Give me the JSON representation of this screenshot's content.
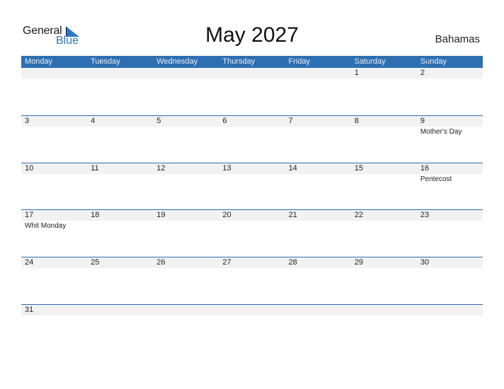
{
  "logo": {
    "text_general": "General",
    "text_blue": "Blue",
    "icon": "logo-triangle-icon"
  },
  "title": "May 2027",
  "country": "Bahamas",
  "colors": {
    "accent": "#2e6fb2",
    "logo_blue": "#2a76c6",
    "strip": "#f2f2f2"
  },
  "weekdays": [
    "Monday",
    "Tuesday",
    "Wednesday",
    "Thursday",
    "Friday",
    "Saturday",
    "Sunday"
  ],
  "weeks": [
    [
      "",
      "",
      "",
      "",
      "",
      "1",
      "2"
    ],
    [
      "3",
      "4",
      "5",
      "6",
      "7",
      "8",
      "9"
    ],
    [
      "10",
      "11",
      "12",
      "13",
      "14",
      "15",
      "16"
    ],
    [
      "17",
      "18",
      "19",
      "20",
      "21",
      "22",
      "23"
    ],
    [
      "24",
      "25",
      "26",
      "27",
      "28",
      "29",
      "30"
    ],
    [
      "31",
      "",
      "",
      "",
      "",
      "",
      ""
    ]
  ],
  "holidays": [
    [
      "",
      "",
      "",
      "",
      "",
      "",
      ""
    ],
    [
      "",
      "",
      "",
      "",
      "",
      "",
      "Mother's Day"
    ],
    [
      "",
      "",
      "",
      "",
      "",
      "",
      "Pentecost"
    ],
    [
      "Whit Monday",
      "",
      "",
      "",
      "",
      "",
      ""
    ],
    [
      "",
      "",
      "",
      "",
      "",
      "",
      ""
    ],
    [
      "",
      "",
      "",
      "",
      "",
      "",
      ""
    ]
  ]
}
